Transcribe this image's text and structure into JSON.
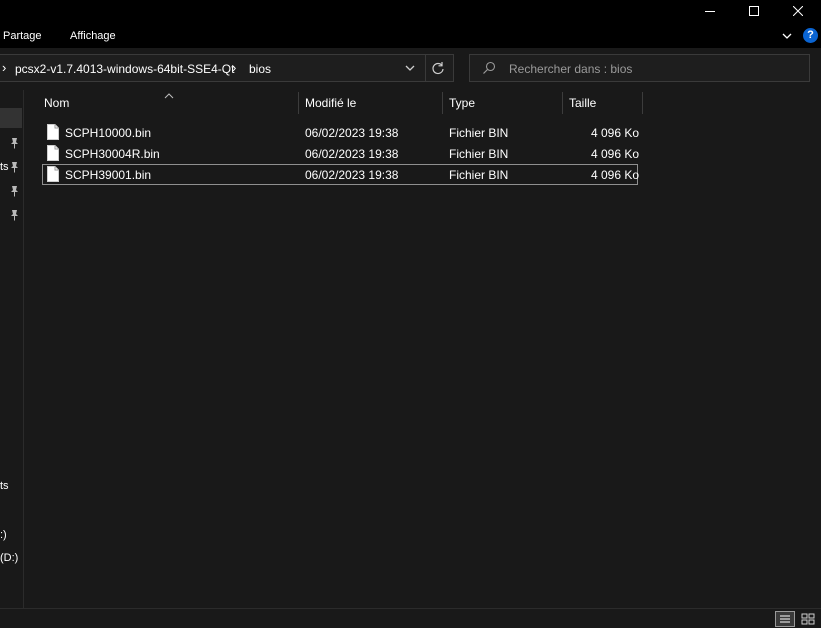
{
  "window": {
    "minimize_icon": "minimize-icon",
    "maximize_icon": "maximize-icon",
    "close_icon": "close-icon"
  },
  "ribbon": {
    "tabs": [
      {
        "label": "Partage"
      },
      {
        "label": "Affichage"
      }
    ],
    "help_glyph": "?",
    "accent_color": "#0a64d2"
  },
  "address": {
    "segments": [
      "pcsx2-v1.7.4013-windows-64bit-SSE4-Qt",
      "bios"
    ],
    "separator_glyph": "›"
  },
  "search": {
    "placeholder": "Rechercher dans : bios"
  },
  "nav": {
    "fragments": [
      "ts",
      "ts",
      "ts",
      ":)",
      "(D:)"
    ]
  },
  "columns": {
    "name": "Nom",
    "modified": "Modifié le",
    "type": "Type",
    "size": "Taille"
  },
  "files": [
    {
      "name": "SCPH10000.bin",
      "modified": "06/02/2023 19:38",
      "type": "Fichier BIN",
      "size": "4 096 Ko",
      "selected": false
    },
    {
      "name": "SCPH30004R.bin",
      "modified": "06/02/2023 19:38",
      "type": "Fichier BIN",
      "size": "4 096 Ko",
      "selected": false
    },
    {
      "name": "SCPH39001.bin",
      "modified": "06/02/2023 19:38",
      "type": "Fichier BIN",
      "size": "4 096 Ko",
      "selected": true
    }
  ]
}
